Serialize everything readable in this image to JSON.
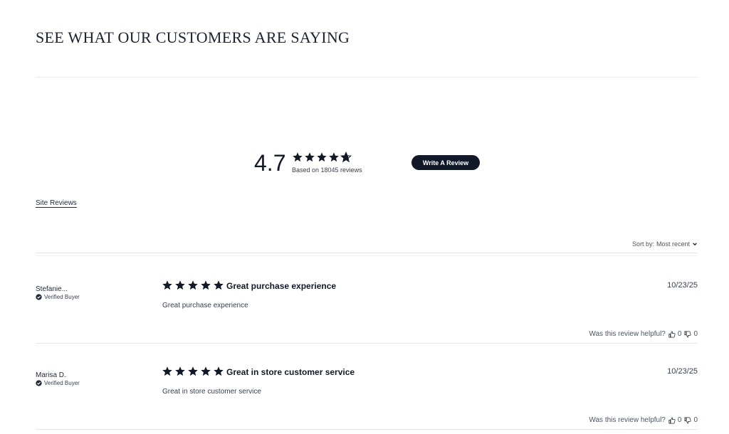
{
  "page": {
    "title": "SEE WHAT OUR CUSTOMERS ARE SAYING"
  },
  "summary": {
    "average": "4.7",
    "rating_value": 4.7,
    "rating_max": 5,
    "based_on": "Based on 18045 reviews",
    "write_review_label": "Write A Review"
  },
  "tabs": {
    "site_reviews": "Site Reviews"
  },
  "sort": {
    "label": "Sort by:",
    "value": "Most recent"
  },
  "reviews": [
    {
      "name": "Stefanie...",
      "badge": "Verified Buyer",
      "rating": 5,
      "title": "Great purchase experience",
      "date": "10/23/25",
      "body": "Great purchase experience",
      "helpful_label": "Was this review helpful?",
      "thumbs_up": "0",
      "thumbs_down": "0"
    },
    {
      "name": "Marisa D.",
      "badge": "Verified Buyer",
      "rating": 5,
      "title": "Great in store customer service",
      "date": "10/23/25",
      "body": "Great in store customer service",
      "helpful_label": "Was this review helpful?",
      "thumbs_up": "0",
      "thumbs_down": "0"
    }
  ],
  "colors": {
    "star": "#111827",
    "button_bg": "#111827",
    "text": "#1f2937"
  },
  "icons": {
    "star": "star-icon",
    "half_star": "half-star-icon",
    "verified": "check-circle-icon",
    "chevron": "chevron-down-icon",
    "thumbs_up": "thumbs-up-icon",
    "thumbs_down": "thumbs-down-icon"
  }
}
